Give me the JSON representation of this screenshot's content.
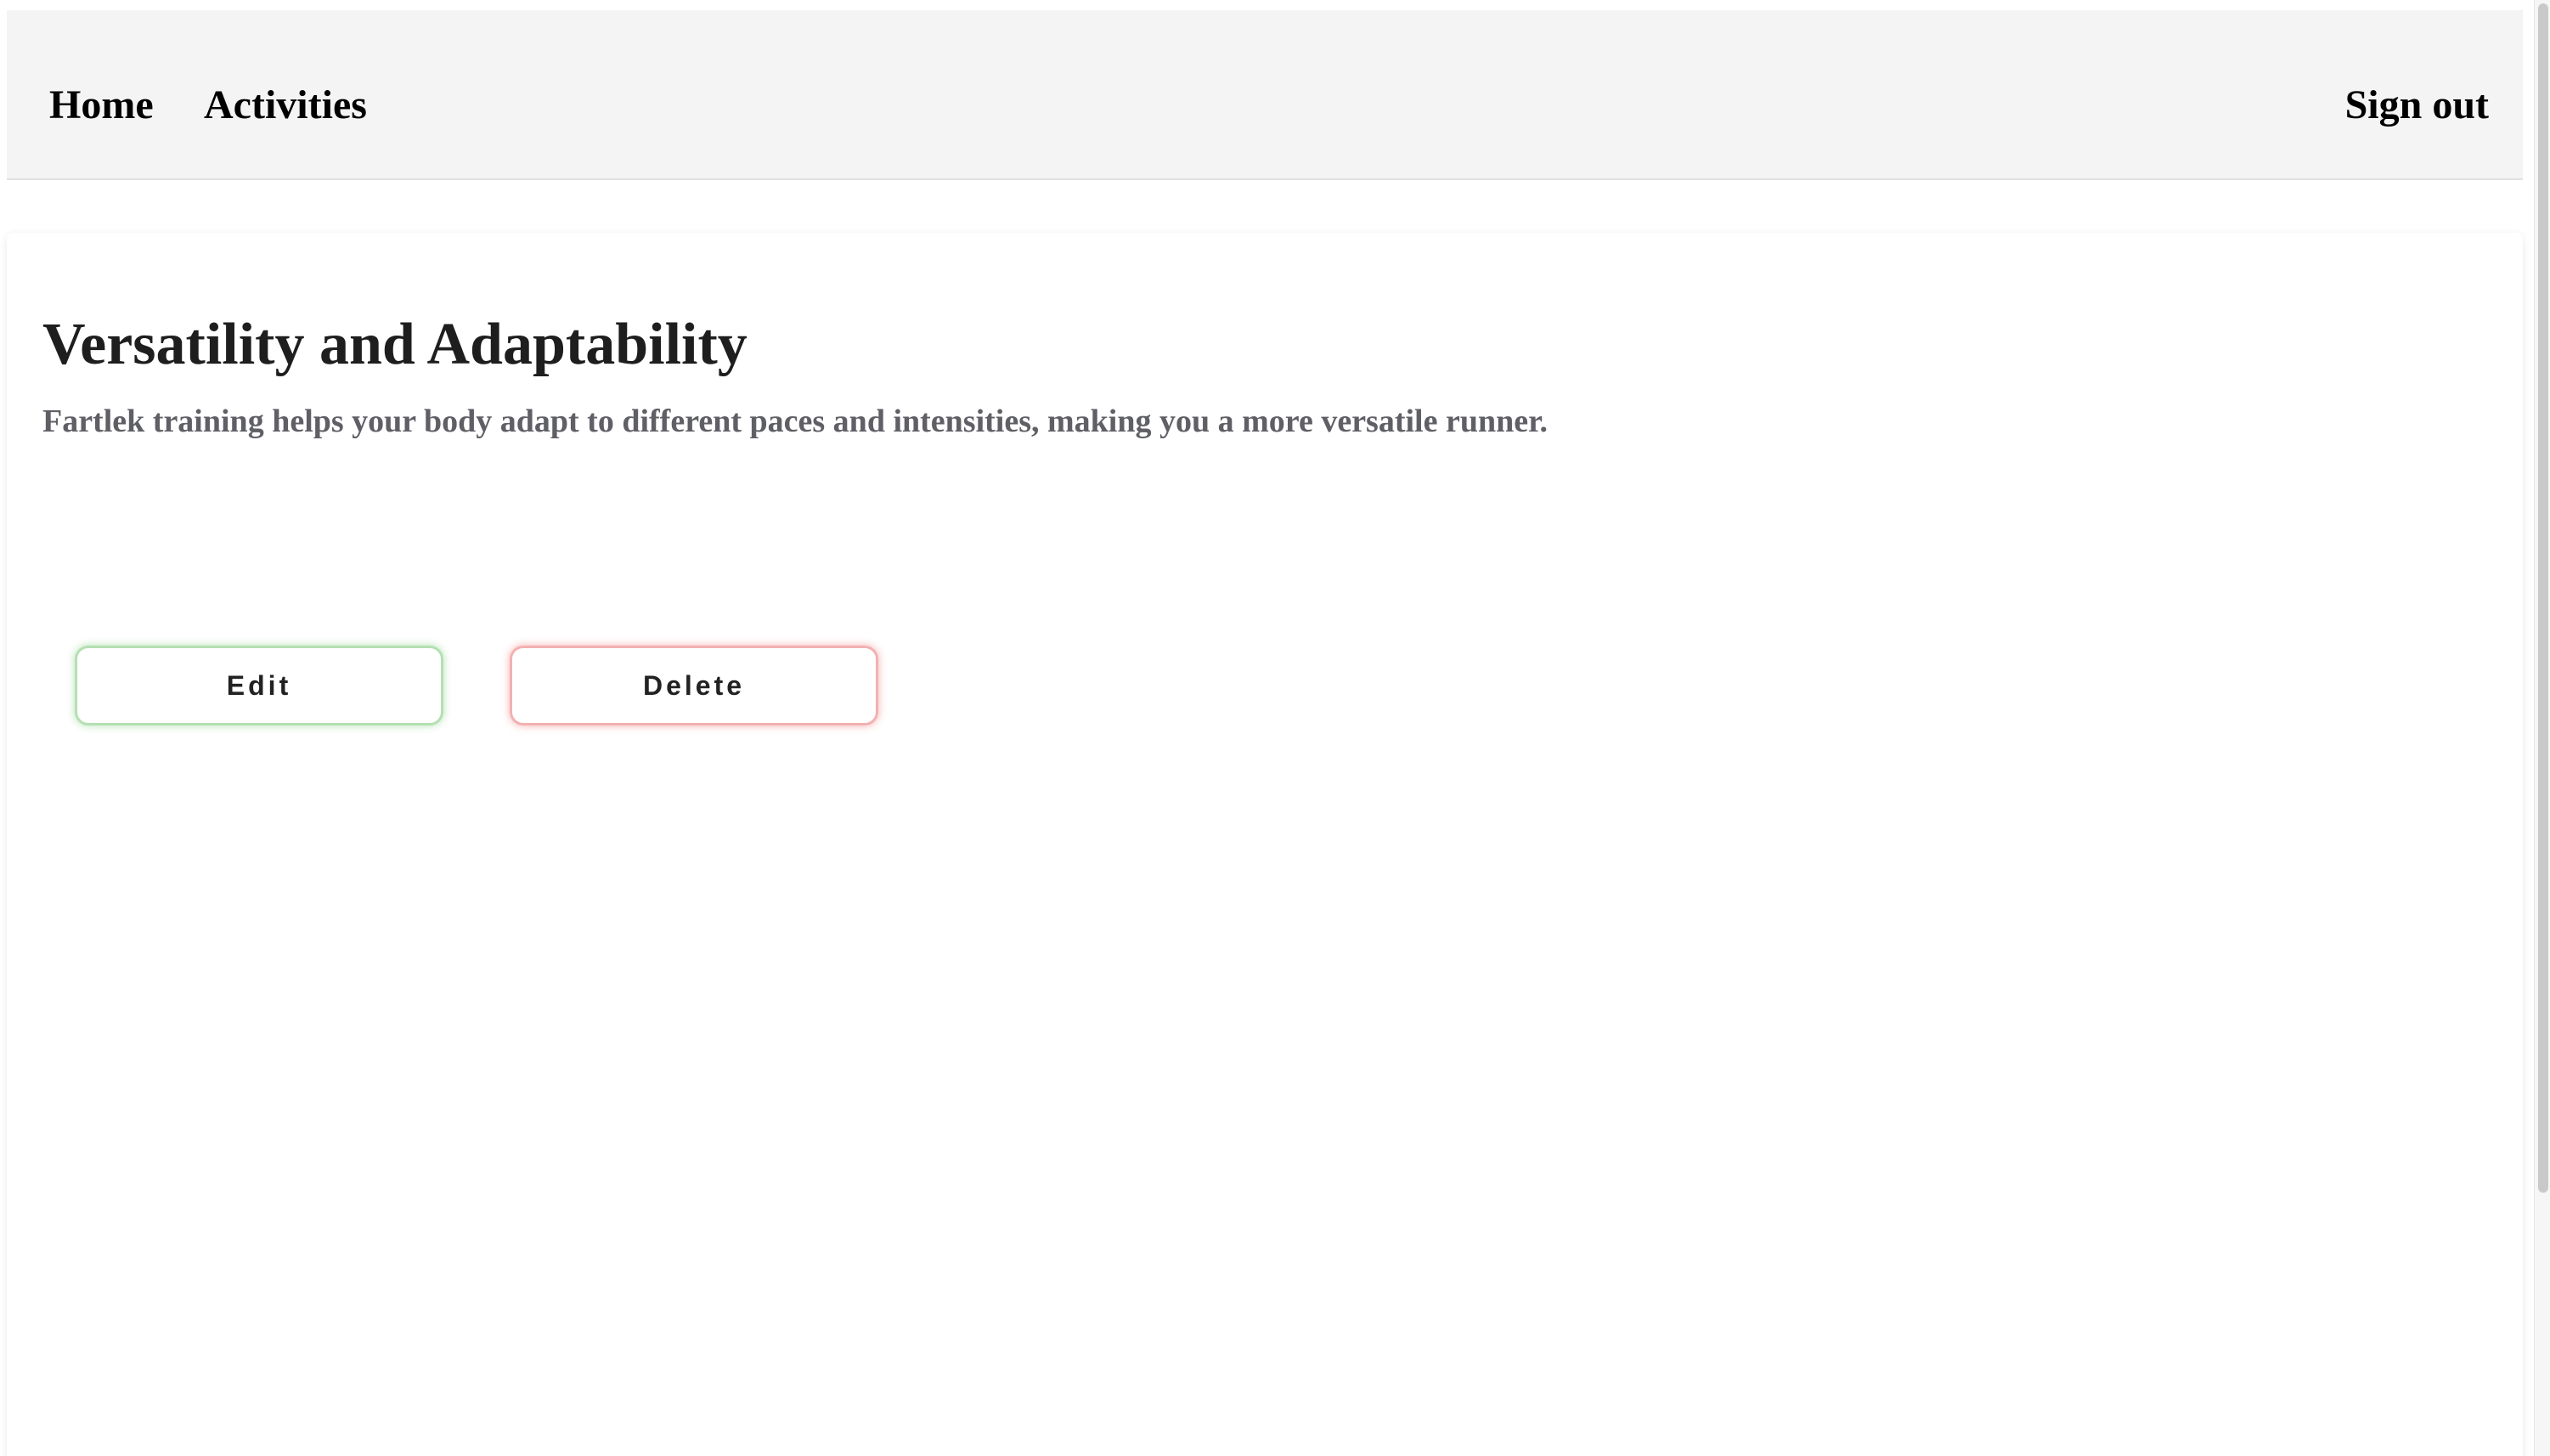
{
  "nav": {
    "home": "Home",
    "activities": "Activities",
    "sign_out": "Sign out"
  },
  "activity": {
    "title": "Versatility and Adaptability",
    "description": "Fartlek training helps your body adapt to different paces and intensities, making you a more versatile runner."
  },
  "actions": {
    "edit": "Edit",
    "delete": "Delete"
  },
  "colors": {
    "navbar_bg": "#f4f4f4",
    "title": "#1e1e1e",
    "description": "#5f5f66",
    "edit_accent": "#b4e0b2",
    "delete_accent": "#f3b1b1"
  }
}
